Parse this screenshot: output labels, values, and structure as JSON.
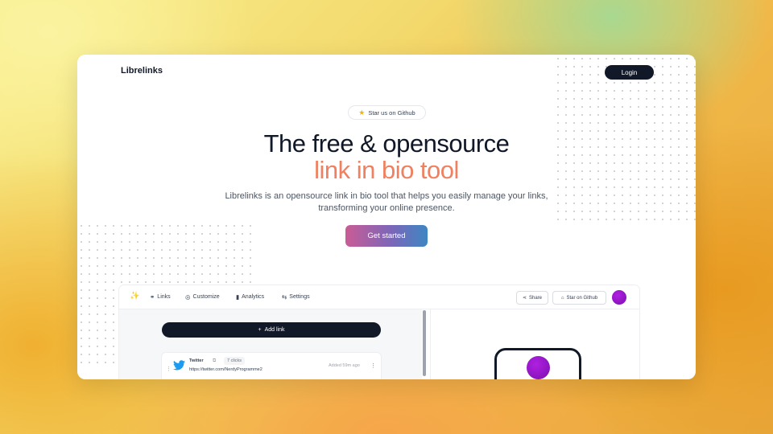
{
  "header": {
    "brand": "Librelinks",
    "login_label": "Login"
  },
  "hero": {
    "badge_label": "Star us on Github",
    "title_line1": "The free & opensource",
    "title_line2": "link in bio tool",
    "description": "Librelinks is an opensource link in bio tool that helps you easily manage your links, transforming your online presence.",
    "cta_label": "Get started"
  },
  "app": {
    "nav": [
      {
        "label": "Links",
        "icon": "link-icon"
      },
      {
        "label": "Customize",
        "icon": "palette-icon"
      },
      {
        "label": "Analytics",
        "icon": "bar-chart-icon"
      },
      {
        "label": "Settings",
        "icon": "sliders-icon"
      }
    ],
    "share_label": "Share",
    "star_github_label": "Star on Github",
    "add_link_label": "Add link",
    "link_row": {
      "title": "Twitter",
      "clicks": "7 clicks",
      "url": "https://twitter.com/NerdyProgramme2",
      "added": "Added 59m ago"
    }
  },
  "colors": {
    "accent_orange": "#ef8060",
    "dark": "#111827",
    "avatar_purple": "#9a18d0"
  }
}
